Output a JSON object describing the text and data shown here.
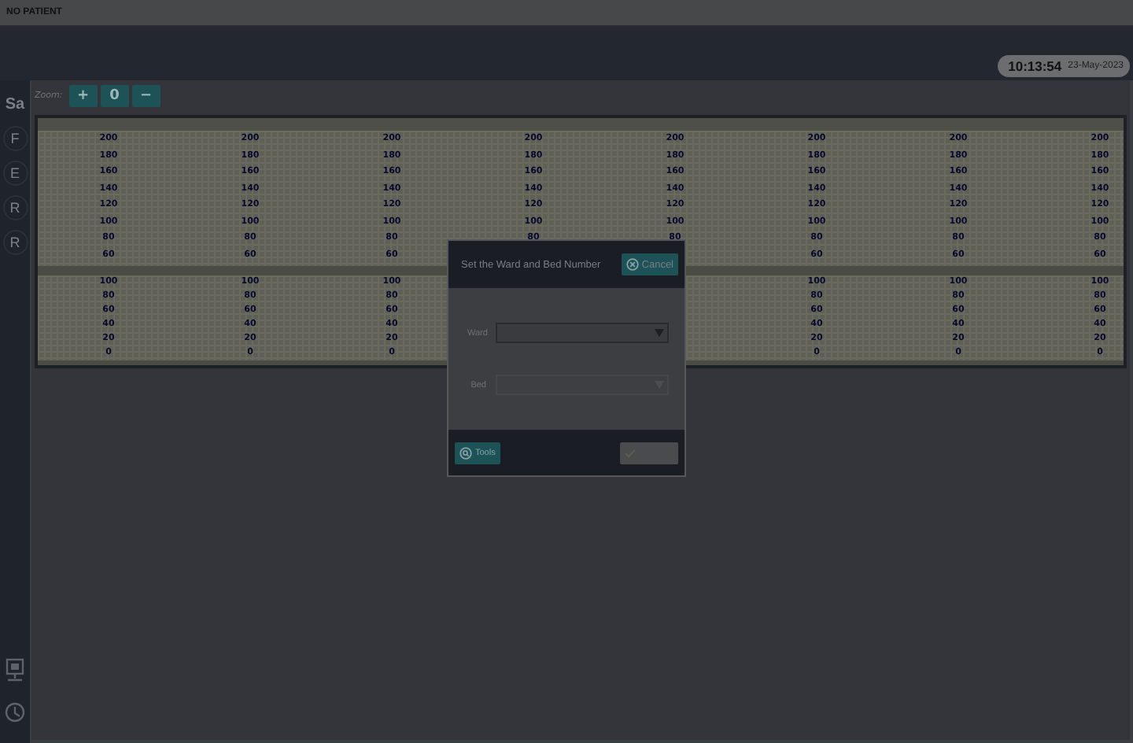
{
  "top_bar": {
    "patient": "NO PATIENT"
  },
  "clock": {
    "time": "10:13:54",
    "date": "23-May-2023"
  },
  "sidebar": {
    "items": [
      {
        "label": "Sa",
        "kind": "plain"
      },
      {
        "label": "F",
        "kind": "circle"
      },
      {
        "label": "E",
        "kind": "circle"
      },
      {
        "label": "R",
        "kind": "circle"
      },
      {
        "label": "R",
        "kind": "circle"
      }
    ],
    "tools": [
      {
        "kind": "monitor"
      },
      {
        "kind": "clock"
      }
    ]
  },
  "zoom": {
    "label": "Zoom:",
    "buttons": [
      "+",
      "0",
      "−"
    ]
  },
  "scale_columns": [
    {
      "upper": [
        "200",
        "180",
        "160",
        "140",
        "120",
        "100",
        "80",
        "60"
      ],
      "lower": [
        "100",
        "80",
        "60",
        "40",
        "20",
        "0"
      ]
    },
    {
      "upper": [
        "200",
        "180",
        "160",
        "140",
        "120",
        "100",
        "80",
        "60"
      ],
      "lower": [
        "100",
        "80",
        "60",
        "40",
        "20",
        "0"
      ]
    },
    {
      "upper": [
        "200",
        "180",
        "160",
        "140",
        "120",
        "100",
        "80",
        "60"
      ],
      "lower": [
        "100",
        "80",
        "60",
        "40",
        "20",
        "0"
      ]
    },
    {
      "upper": [
        "200",
        "180",
        "160",
        "140",
        "120",
        "100",
        "80"
      ]
    },
    {
      "upper": [
        "200",
        "180",
        "160",
        "140",
        "120",
        "100",
        "80"
      ]
    },
    {
      "upper": [
        "200",
        "180",
        "160",
        "140",
        "120",
        "100",
        "80",
        "60"
      ],
      "lower": [
        "100",
        "80",
        "60",
        "40",
        "20",
        "0"
      ]
    },
    {
      "upper": [
        "200",
        "180",
        "160",
        "140",
        "120",
        "100",
        "80",
        "60"
      ],
      "lower": [
        "100",
        "80",
        "60",
        "40",
        "20",
        "0"
      ]
    },
    {
      "upper": [
        "200",
        "180",
        "160",
        "140",
        "120",
        "100",
        "80",
        "60"
      ],
      "lower": [
        "100",
        "80",
        "60",
        "40",
        "20",
        "0"
      ]
    }
  ],
  "dialog": {
    "title": "Set the Ward and Bed Number",
    "cancel": "Cancel",
    "fields": [
      {
        "label": "Ward",
        "disabled": false
      },
      {
        "label": "Bed",
        "disabled": true
      }
    ],
    "tools_button": "Tools",
    "confirm_disabled": true
  }
}
